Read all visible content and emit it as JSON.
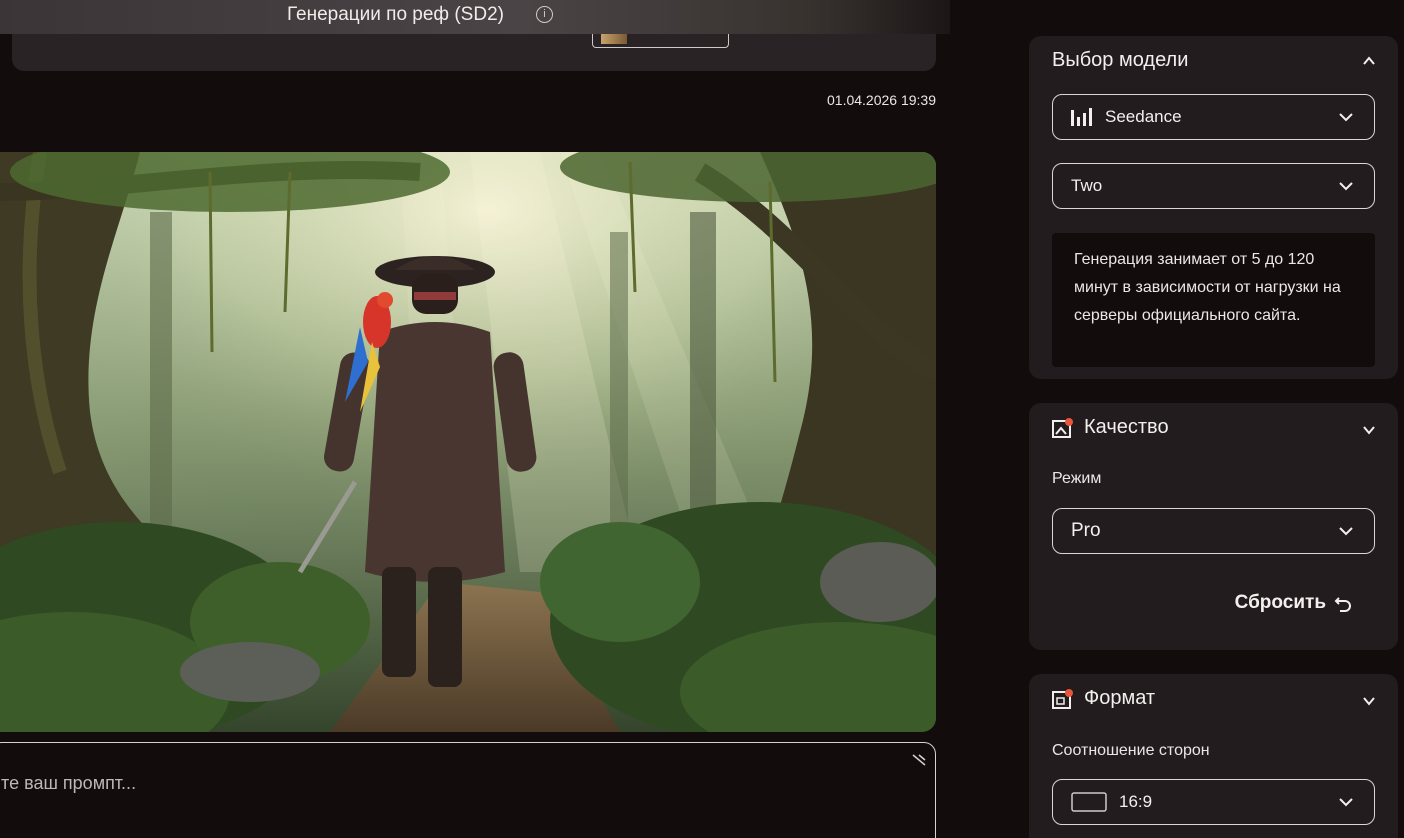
{
  "header": {
    "title": "Генерации по реф (SD2)",
    "info_icon": "info-icon"
  },
  "history": {
    "timestamp": "01.04.2026 19:39"
  },
  "prompt": {
    "placeholder": "ите ваш промпт..."
  },
  "model_panel": {
    "title": "Выбор модели",
    "model_select": {
      "value": "Seedance",
      "icon": "bars-icon"
    },
    "version_select": {
      "value": "Two"
    },
    "note": "Генерация занимает от 5 до 120 минут в зависимости от нагрузки на серверы официального сайта."
  },
  "quality_panel": {
    "title": "Качество",
    "mode_label": "Режим",
    "mode_select": {
      "value": "Pro"
    },
    "reset_label": "Сбросить"
  },
  "format_panel": {
    "title": "Формат",
    "ratio_label": "Соотношение сторон",
    "ratio_select": {
      "value": "16:9"
    }
  },
  "colors": {
    "background": "#120c0d",
    "panel": "#221c1e",
    "accent_dot": "#e8553b",
    "border": "#dcd7d6"
  }
}
